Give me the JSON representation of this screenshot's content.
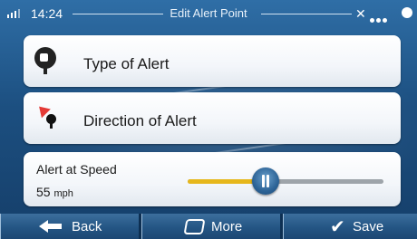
{
  "status": {
    "time": "14:24",
    "title": "Edit Alert Point"
  },
  "rows": {
    "type_label": "Type of Alert",
    "direction_label": "Direction of Alert",
    "speed_label": "Alert at Speed",
    "speed_value": "55",
    "speed_unit": "mph",
    "slider_fraction": 0.4
  },
  "icons": {
    "signal": "signal-icon",
    "satellite": "satellite-icon",
    "camera": "speed-camera-icon",
    "direction": "direction-pin-icon",
    "back": "arrow-left-icon",
    "more": "more-icon",
    "save": "checkmark-icon"
  },
  "colors": {
    "accent_yellow": "#e6b71c",
    "direction_red": "#e43a36",
    "button_blue": "#245584"
  },
  "bottom": {
    "back_label": "Back",
    "more_label": "More",
    "save_label": "Save"
  }
}
